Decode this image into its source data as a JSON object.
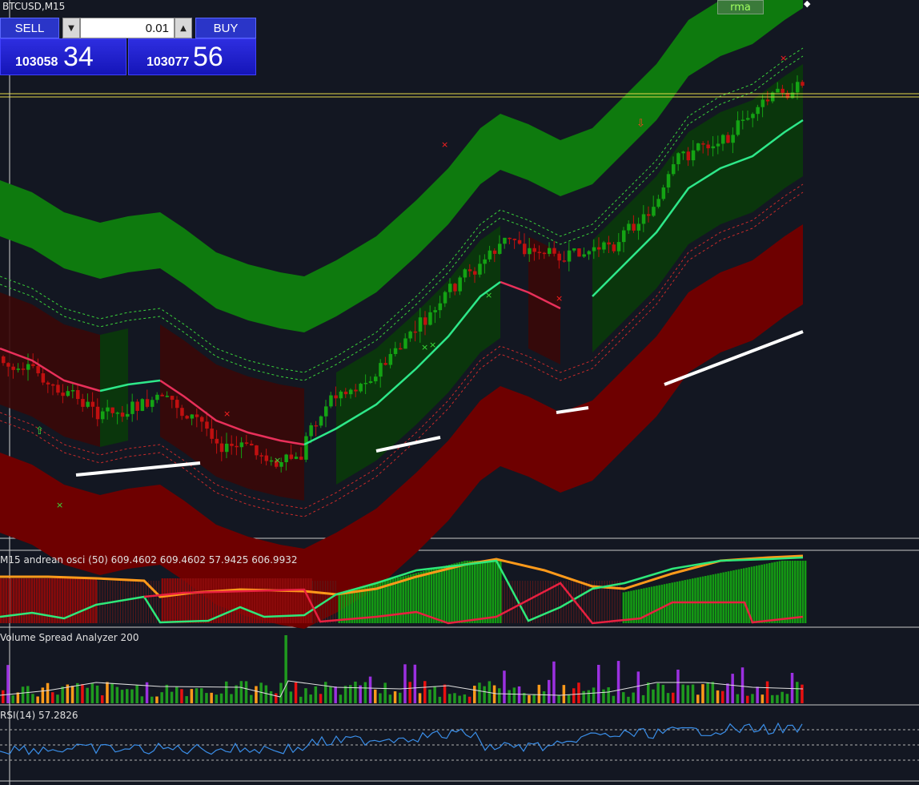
{
  "chart": {
    "title": "BTCUSD,M15",
    "indicator_tag": "rma"
  },
  "trade_panel": {
    "sell_label": "SELL",
    "buy_label": "BUY",
    "lot_value": "0.01",
    "sell_price_main": "103058",
    "sell_price_big": "34",
    "buy_price_main": "103077",
    "buy_price_big": "56"
  },
  "subpanels": {
    "osc_title": "M15 andrean osci (50) 609.4602 609.4602 57.9425 606.9932",
    "vsa_title": "Volume Spread Analyzer 200",
    "rsi_title": "RSI(14) 57.2826"
  },
  "colors": {
    "background": "#131722",
    "bull_band": "#0e7a0e",
    "bear_band": "#6e0000",
    "basis_bull": "#2ee88a",
    "basis_bear": "#e8305a",
    "orange": "#ff9a1a",
    "rsi": "#3a8ee8",
    "volume_green": "#1f9a1f",
    "volume_orange": "#ff9a1a",
    "volume_red": "#e81010",
    "volume_purple": "#9b30e0"
  },
  "icons": {
    "up_arrow": "arrow-up-icon",
    "down_arrow": "arrow-down-icon",
    "cross": "x-marker-icon"
  }
}
